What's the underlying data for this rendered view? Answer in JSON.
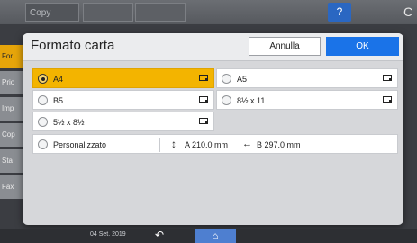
{
  "topbar": {
    "tab_title": "Copy",
    "help_label": "?",
    "right_glyph": "C"
  },
  "sidebar": {
    "items": [
      "For",
      "Prio",
      "Imp",
      "Cop",
      "Sta",
      "Fax"
    ]
  },
  "dialog": {
    "title": "Formato carta",
    "cancel_label": "Annulla",
    "ok_label": "OK",
    "options": [
      {
        "label": "A4",
        "selected": true
      },
      {
        "label": "A5",
        "selected": false
      },
      {
        "label": "B5",
        "selected": false
      },
      {
        "label": "8½ x 11",
        "selected": false
      },
      {
        "label": "5½ x 8½",
        "selected": false
      }
    ],
    "custom": {
      "label": "Personalizzato",
      "dim_a": "A 210.0 mm",
      "dim_b": "B 297.0 mm"
    }
  },
  "bottombar": {
    "date": "04 Set. 2019"
  },
  "colors": {
    "selected": "#f3b400",
    "ok_button": "#1a73e8",
    "sidebar_active": "#e6a50a"
  }
}
